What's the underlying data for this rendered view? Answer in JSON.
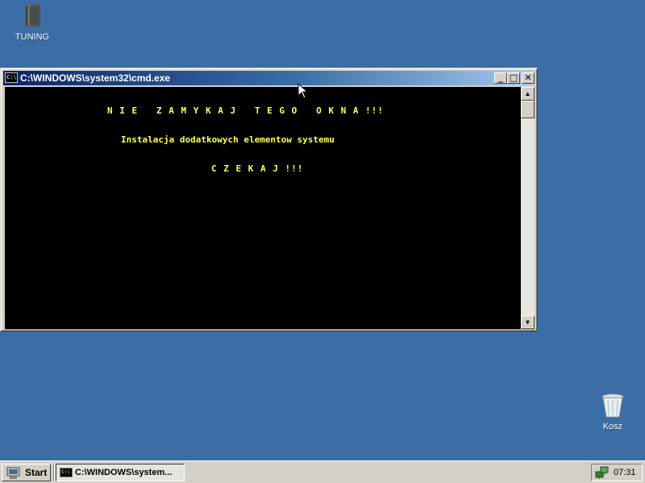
{
  "desktop": {
    "background_color": "#3a6ea5",
    "icons": [
      {
        "label": "TUNING",
        "icon": "folder-icon"
      },
      {
        "label": "Kosz",
        "icon": "recycle-bin-icon"
      }
    ]
  },
  "window": {
    "title": "C:\\WINDOWS\\system32\\cmd.exe",
    "icon_glyph": "C:\\",
    "buttons": {
      "minimize": "_",
      "maximize": "□",
      "close": "✕"
    },
    "console": {
      "text_color": "#ffff54",
      "background_color": "#000000",
      "lines": [
        "N I E   Z A M Y K A J   T E G O   O K N A !!!",
        "Instalacja dodatkowych elementow systemu",
        "C Z E K A J !!!"
      ]
    },
    "scrollbar": {
      "up": "▲",
      "down": "▼"
    }
  },
  "taskbar": {
    "start_label": "Start",
    "tasks": [
      {
        "label": "C:\\WINDOWS\\system...",
        "icon_glyph": "C:\\"
      }
    ],
    "clock": "07:31"
  }
}
